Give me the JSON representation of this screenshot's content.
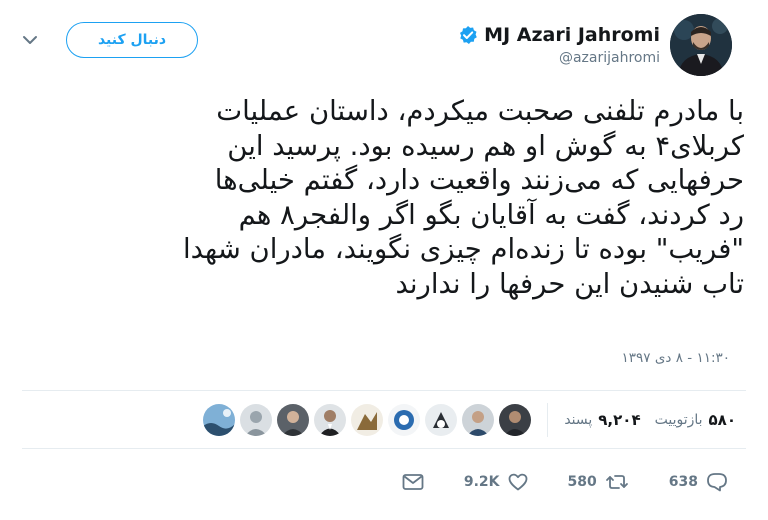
{
  "header": {
    "display_name": "MJ Azari Jahromi",
    "handle": "@azarijahromi",
    "follow_label": "دنبال کنید",
    "avatar_icon": "profile-photo",
    "verified_icon": "verified-badge-icon",
    "caret_icon": "chevron-down-icon"
  },
  "tweet": {
    "lines": [
      "با مادرم تلفنی صحبت میکردم، داستان عملیات",
      "کربلای۴ به گوش او هم رسیده بود. پرسید این",
      "حرفهایی که می‌زنند واقعیت دارد، گفتم خیلی‌ها",
      "رد کردند، گفت به آقایان بگو اگر والفجر۸ هم",
      "\"فریب\" بوده تا زنده‌ام چیزی نگویند، مادران شهدا",
      "تاب شنیدن این حرفها را ندارند"
    ],
    "timestamp": "۱۱:۳۰ - ۸ دی ۱۳۹۷"
  },
  "stats": {
    "retweets_count": "۵۸۰",
    "retweets_label": "بازتوییت",
    "likes_count": "۹,۲۰۴",
    "likes_label": "پسند"
  },
  "actions": {
    "reply_count": "638",
    "retweet_count": "580",
    "like_count": "9.2K"
  },
  "colors": {
    "accent": "#1da1f2",
    "text": "#14171a",
    "muted": "#657786",
    "divider": "#e6ecf0"
  }
}
